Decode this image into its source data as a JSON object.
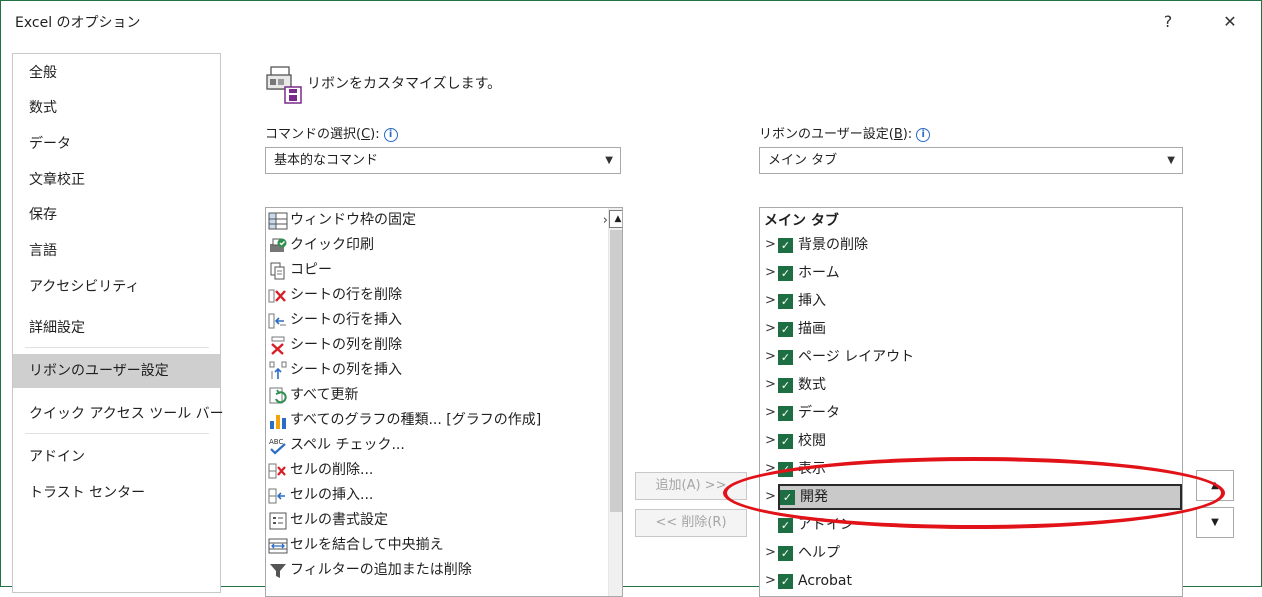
{
  "window": {
    "title": "Excel のオプション",
    "help_label": "?",
    "close_label": "✕",
    "border_color": "#217346"
  },
  "nav": {
    "items": [
      {
        "label": "全般"
      },
      {
        "label": "数式"
      },
      {
        "label": "データ"
      },
      {
        "label": "文章校正"
      },
      {
        "label": "保存"
      },
      {
        "label": "言語"
      },
      {
        "label": "アクセシビリティ"
      },
      {
        "label": "詳細設定"
      },
      {
        "label": "リボンのユーザー設定",
        "selected": true
      },
      {
        "label": "クイック アクセス ツール バー"
      },
      {
        "label": "アドイン"
      },
      {
        "label": "トラスト センター"
      }
    ]
  },
  "heading": {
    "text": "リボンをカスタマイズします。",
    "icon": "customize-ribbon-icon"
  },
  "commands": {
    "label": "コマンドの選択(",
    "accel": "C",
    "label_end": "):",
    "info_icon": "ⓘ",
    "combo_value": "基本的なコマンド",
    "items": [
      {
        "label": "ウィンドウ枠の固定",
        "icon": "freeze-panes-icon",
        "expander": "›"
      },
      {
        "label": "クイック印刷",
        "icon": "quick-print-icon"
      },
      {
        "label": "コピー",
        "icon": "copy-icon"
      },
      {
        "label": "シートの行を削除",
        "icon": "delete-row-icon"
      },
      {
        "label": "シートの行を挿入",
        "icon": "insert-row-icon"
      },
      {
        "label": "シートの列を削除",
        "icon": "delete-column-icon"
      },
      {
        "label": "シートの列を挿入",
        "icon": "insert-column-icon"
      },
      {
        "label": "すべて更新",
        "icon": "refresh-all-icon"
      },
      {
        "label": "すべてのグラフの種類... [グラフの作成]",
        "icon": "chart-icon"
      },
      {
        "label": "スペル チェック...",
        "icon": "spelling-icon"
      },
      {
        "label": "セルの削除...",
        "icon": "delete-cells-icon"
      },
      {
        "label": "セルの挿入...",
        "icon": "insert-cells-icon"
      },
      {
        "label": "セルの書式設定",
        "icon": "format-cells-icon"
      },
      {
        "label": "セルを結合して中央揃え",
        "icon": "merge-center-icon"
      },
      {
        "label": "フィルターの追加または削除",
        "icon": "filter-icon"
      }
    ]
  },
  "buttons": {
    "add": "追加(A) >>",
    "remove": "<< 削除(R)"
  },
  "ribbon": {
    "label": "リボンのユーザー設定(",
    "accel": "B",
    "label_end": "):",
    "info_icon": "ⓘ",
    "combo_value": "メイン タブ",
    "tree_header": "メイン タブ",
    "tabs": [
      {
        "label": "背景の削除",
        "checked": true
      },
      {
        "label": "ホーム",
        "checked": true
      },
      {
        "label": "挿入",
        "checked": true
      },
      {
        "label": "描画",
        "checked": true
      },
      {
        "label": "ページ レイアウト",
        "checked": true
      },
      {
        "label": "数式",
        "checked": true
      },
      {
        "label": "データ",
        "checked": true
      },
      {
        "label": "校閲",
        "checked": true
      },
      {
        "label": "表示",
        "checked": true
      },
      {
        "label": "開発",
        "checked": true,
        "selected": true
      },
      {
        "label": "アドイン",
        "checked": true
      },
      {
        "label": "ヘルプ",
        "checked": true
      },
      {
        "label": "Acrobat",
        "checked": true
      }
    ]
  },
  "highlight_color": "#e11218",
  "check_color": "#1e6e44"
}
